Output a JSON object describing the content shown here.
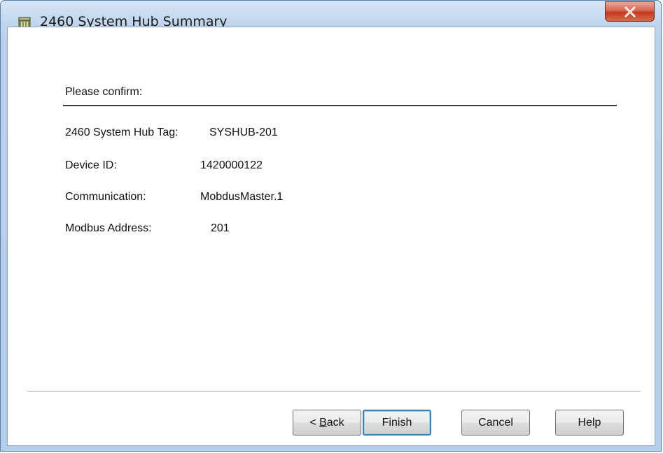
{
  "window": {
    "title": "2460 System Hub Summary",
    "title_icon": "device-icon",
    "close_icon": "close-icon"
  },
  "summary": {
    "prompt": "Please confirm:",
    "rows": [
      {
        "label": "2460 System Hub Tag:",
        "value": "SYSHUB-201"
      },
      {
        "label": "Device ID:",
        "value": "1420000122"
      },
      {
        "label": "Communication:",
        "value": "MobdusMaster.1"
      },
      {
        "label": "Modbus Address:",
        "value": "201"
      }
    ]
  },
  "buttons": {
    "back_prefix": "< ",
    "back_mnemonic": "B",
    "back_rest": "ack",
    "finish": "Finish",
    "cancel": "Cancel",
    "help": "Help"
  }
}
